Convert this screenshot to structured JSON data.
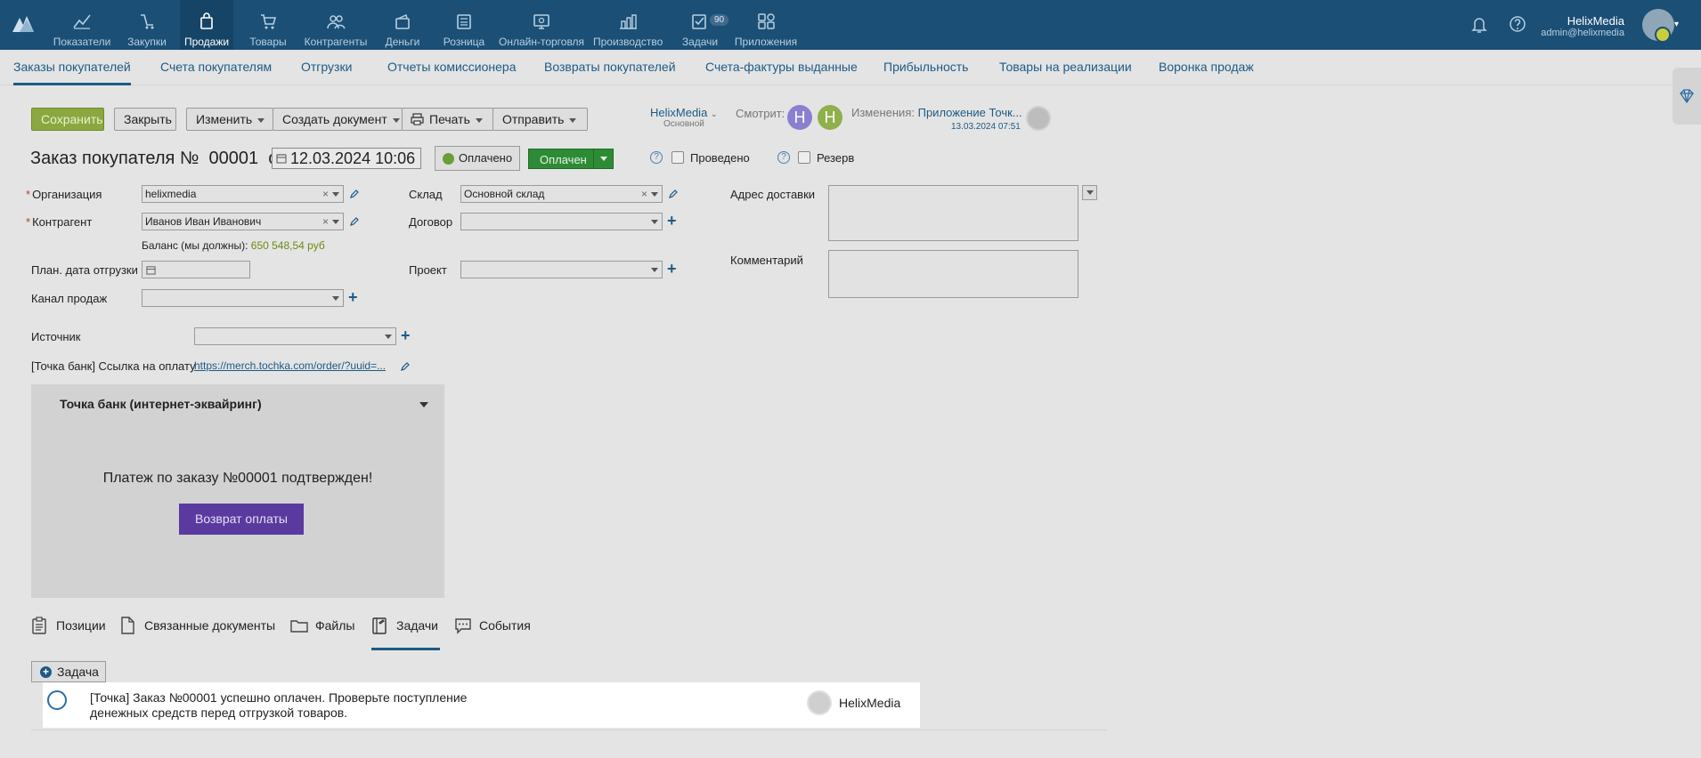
{
  "nav": {
    "items": [
      {
        "label": "Показатели",
        "icon": "chart-line-icon"
      },
      {
        "label": "Закупки",
        "icon": "purchases-icon"
      },
      {
        "label": "Продажи",
        "icon": "bag-icon"
      },
      {
        "label": "Товары",
        "icon": "cart-icon"
      },
      {
        "label": "Контрагенты",
        "icon": "people-icon"
      },
      {
        "label": "Деньги",
        "icon": "wallet-icon"
      },
      {
        "label": "Розница",
        "icon": "register-icon"
      },
      {
        "label": "Онлайн-торговля",
        "icon": "online-store-icon"
      },
      {
        "label": "Производство",
        "icon": "production-icon"
      },
      {
        "label": "Задачи",
        "icon": "tasks-icon"
      },
      {
        "label": "Приложения",
        "icon": "apps-icon"
      }
    ],
    "tasks_badge": "90",
    "user_name": "HelixMedia",
    "user_email": "admin@helixmedia"
  },
  "subnav": [
    "Заказы покупателей",
    "Счета покупателям",
    "Отгрузки",
    "Отчеты комиссионера",
    "Возвраты покупателей",
    "Счета-фактуры выданные",
    "Прибыльность",
    "Товары на реализации",
    "Воронка продаж"
  ],
  "toolbar": {
    "save": "Сохранить",
    "close": "Закрыть",
    "edit": "Изменить",
    "create_doc": "Создать документ",
    "print": "Печать",
    "send": "Отправить"
  },
  "owner": {
    "name": "HelixMedia",
    "sub": "Основной"
  },
  "watch_label": "Смотрит:",
  "watchers": [
    "H",
    "H"
  ],
  "changes": {
    "label": "Изменения:",
    "value": "Приложение Точк...",
    "date": "13.03.2024 07:51"
  },
  "doc": {
    "title_prefix": "Заказ покупателя №",
    "number": "00001",
    "from": "от",
    "date": "12.03.2024 10:06",
    "paid_button": "Оплачено",
    "status": "Оплачен",
    "posted_label": "Проведено",
    "reserve_label": "Резерв",
    "help": "?"
  },
  "form": {
    "org_label": "Организация",
    "org_value": "helixmedia",
    "counterparty_label": "Контрагент",
    "counterparty_value": "Иванов Иван Иванович",
    "balance_label": "Баланс (мы должны):",
    "balance_value": "650 548,54 руб",
    "ship_date_label": "План. дата отгрузки",
    "channel_label": "Канал продаж",
    "warehouse_label": "Склад",
    "warehouse_value": "Основной склад",
    "contract_label": "Договор",
    "project_label": "Проект",
    "delivery_label": "Адрес доставки",
    "comment_label": "Комментарий",
    "source_label": "Источник",
    "paylink_label": "[Точка банк] Ссылка на оплату",
    "paylink_value": "https://merch.tochka.com/order/?uuid=..."
  },
  "bank": {
    "title": "Точка банк (интернет-эквайринг)",
    "message": "Платеж по заказу №00001 подтвержден!",
    "refund_button": "Возврат оплаты"
  },
  "tabs": [
    "Позиции",
    "Связанные документы",
    "Файлы",
    "Задачи",
    "События"
  ],
  "task_button": "Задача",
  "task": {
    "text": "[Точка] Заказ №00001 успешно оплачен. Проверьте поступление денежных средств перед отгрузкой товаров.",
    "user": "HelixMedia"
  }
}
